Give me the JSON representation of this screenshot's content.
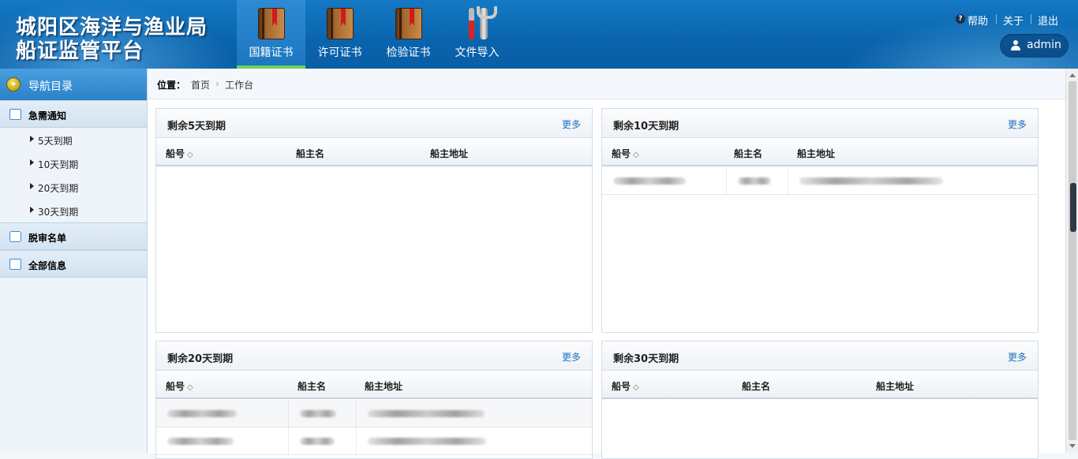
{
  "header": {
    "title_line1": "城阳区海洋与渔业局",
    "title_line2": "船证监管平台",
    "nav": [
      {
        "label": "国籍证书",
        "icon": "book-icon",
        "active": true
      },
      {
        "label": "许可证书",
        "icon": "book-icon",
        "active": false
      },
      {
        "label": "检验证书",
        "icon": "book-icon",
        "active": false
      },
      {
        "label": "文件导入",
        "icon": "tools-icon",
        "active": false
      }
    ],
    "links": {
      "help": "帮助",
      "about": "关于",
      "logout": "退出"
    },
    "user": "admin",
    "colors": {
      "header_bg": "#0a64ad",
      "active_underline": "#6bd35a"
    }
  },
  "sidebar": {
    "title": "导航目录",
    "sections": [
      {
        "label": "急需通知",
        "icon": "list-icon",
        "items": [
          "5天到期",
          "10天到期",
          "20天到期",
          "30天到期"
        ]
      },
      {
        "label": "脱审名单",
        "icon": "comment-icon",
        "items": []
      },
      {
        "label": "全部信息",
        "icon": "edit-icon",
        "items": []
      }
    ]
  },
  "breadcrumb": {
    "label": "位置：",
    "home": "首页",
    "separator": "›",
    "current": "工作台"
  },
  "panels": [
    {
      "title": "剩余5天到期",
      "more": "更多",
      "columns": [
        "船号",
        "船主名",
        "船主地址"
      ],
      "sort_symbol": "◇",
      "rows": 0
    },
    {
      "title": "剩余10天到期",
      "more": "更多",
      "columns": [
        "船号",
        "船主名",
        "船主地址"
      ],
      "sort_symbol": "◇",
      "rows": 1
    },
    {
      "title": "剩余20天到期",
      "more": "更多",
      "columns": [
        "船号",
        "船主名",
        "船主地址"
      ],
      "sort_symbol": "◇",
      "rows": 2
    },
    {
      "title": "剩余30天到期",
      "more": "更多",
      "columns": [
        "船号",
        "船主名",
        "船主地址"
      ],
      "sort_symbol": "◇",
      "rows": 0
    }
  ]
}
